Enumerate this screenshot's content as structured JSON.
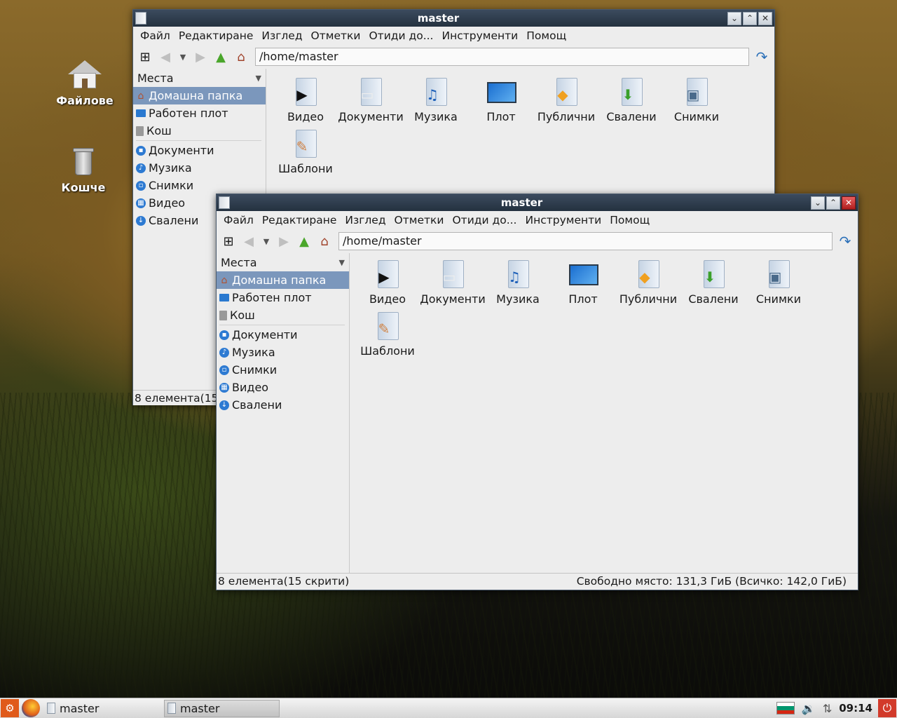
{
  "desktop": {
    "icons": [
      {
        "label": "Файлове"
      },
      {
        "label": "Кошче"
      }
    ]
  },
  "window_back": {
    "title": "master",
    "status_left": "8 елемента(15 с"
  },
  "window_front": {
    "title": "master",
    "status_left": "8 елемента(15 скрити)",
    "status_right": "Свободно място: 131,3 ГиБ (Всичко: 142,0 ГиБ)"
  },
  "menu": [
    "Файл",
    "Редактиране",
    "Изглед",
    "Отметки",
    "Отиди до...",
    "Инструменти",
    "Помощ"
  ],
  "path": "/home/master",
  "sidebar": {
    "header": "Места",
    "items": [
      {
        "label": "Домашна папка",
        "icon": "home-icon"
      },
      {
        "label": "Работен плот",
        "icon": "desktop-icon"
      },
      {
        "label": "Кош",
        "icon": "trash-icon"
      },
      {
        "label": "Документи",
        "icon": "documents-icon"
      },
      {
        "label": "Музика",
        "icon": "music-icon"
      },
      {
        "label": "Снимки",
        "icon": "pictures-icon"
      },
      {
        "label": "Видео",
        "icon": "video-icon"
      },
      {
        "label": "Свалени",
        "icon": "downloads-icon"
      }
    ]
  },
  "files": [
    {
      "label": "Видео",
      "icon": "video-folder-icon"
    },
    {
      "label": "Документи",
      "icon": "documents-folder-icon"
    },
    {
      "label": "Музика",
      "icon": "music-folder-icon"
    },
    {
      "label": "Плот",
      "icon": "desktop-folder-icon"
    },
    {
      "label": "Публични",
      "icon": "public-folder-icon"
    },
    {
      "label": "Свалени",
      "icon": "downloads-folder-icon"
    },
    {
      "label": "Снимки",
      "icon": "pictures-folder-icon"
    },
    {
      "label": "Шаблони",
      "icon": "templates-folder-icon"
    }
  ],
  "taskbar": {
    "tasks": [
      "master",
      "master"
    ],
    "clock": "09:14"
  },
  "colors": {
    "titlebar": "#2e3b4c",
    "selection": "#7b97bc",
    "close": "#c62828"
  }
}
